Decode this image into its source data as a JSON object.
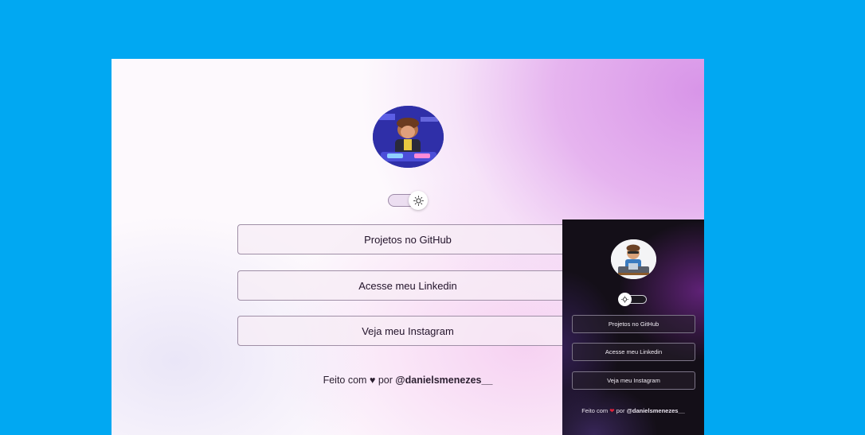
{
  "desktop": {
    "avatar_alt": "avatar",
    "theme": "light",
    "buttons": {
      "github": "Projetos no GitHub",
      "linkedin": "Acesse meu Linkedin",
      "instagram": "Veja meu Instagram"
    },
    "footer": {
      "prefix": "Feito com",
      "heart": "♥",
      "middle": "por",
      "handle": "@danielsmenezes__"
    }
  },
  "mobile": {
    "theme": "dark",
    "buttons": {
      "github": "Projetos no GitHub",
      "linkedin": "Acesse meu Linkedin",
      "instagram": "Veja meu Instagram"
    },
    "footer": {
      "prefix": "Feito com",
      "heart": "❤",
      "middle": "por",
      "handle": "@danielsmenezes__"
    }
  },
  "colors": {
    "background": "#01a8f2",
    "light_accent": "#d895e8",
    "dark_bg": "#140f18"
  },
  "icons": {
    "theme_toggle_light": "sun-icon",
    "theme_toggle_dark": "moon-icon"
  }
}
